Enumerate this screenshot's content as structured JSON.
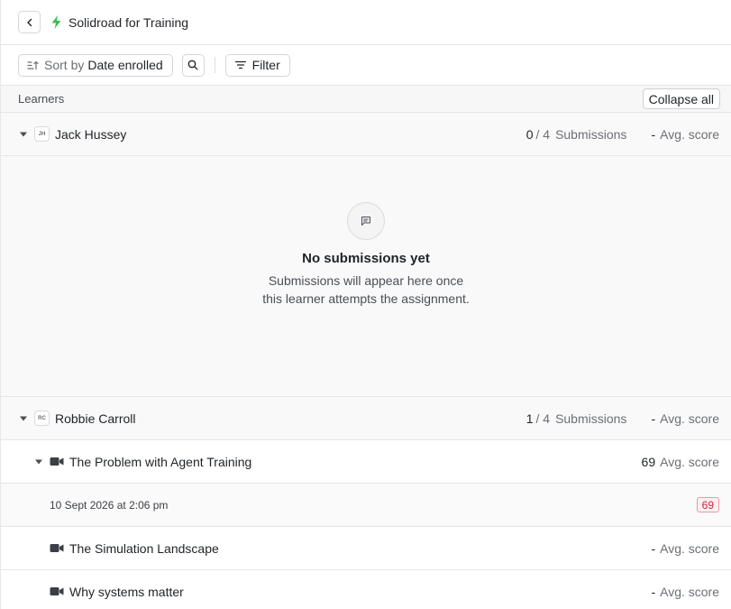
{
  "header": {
    "title": "Solidroad for Training"
  },
  "toolbar": {
    "sort_prefix": "Sort by",
    "sort_value": "Date enrolled",
    "filter_label": "Filter"
  },
  "section": {
    "label": "Learners",
    "collapse_label": "Collapse all"
  },
  "learners": [
    {
      "initials": "JH",
      "name": "Jack Hussey",
      "submissions_done": "0",
      "submissions_total": "/ 4",
      "submissions_word": "Submissions",
      "avg_value": "-",
      "avg_word": "Avg. score",
      "empty_title": "No submissions yet",
      "empty_desc": "Submissions will appear here once this learner attempts the assignment."
    },
    {
      "initials": "RC",
      "name": "Robbie Carroll",
      "submissions_done": "1",
      "submissions_total": "/ 4",
      "submissions_word": "Submissions",
      "avg_value": "-",
      "avg_word": "Avg. score",
      "assignments": [
        {
          "name": "The Problem with Agent Training",
          "avg_value": "69",
          "avg_word": "Avg. score"
        },
        {
          "name": "The Simulation Landscape",
          "avg_value": "-",
          "avg_word": "Avg. score"
        },
        {
          "name": "Why systems matter",
          "avg_value": "-",
          "avg_word": "Avg. score"
        }
      ],
      "submission": {
        "date": "10 Sept 2026 at 2:06 pm",
        "score": "69"
      }
    }
  ],
  "colors": {
    "accent_bolt": "#3fbf4f",
    "score_badge_text": "#c7283d",
    "score_badge_bg": "#fdf0f2"
  }
}
